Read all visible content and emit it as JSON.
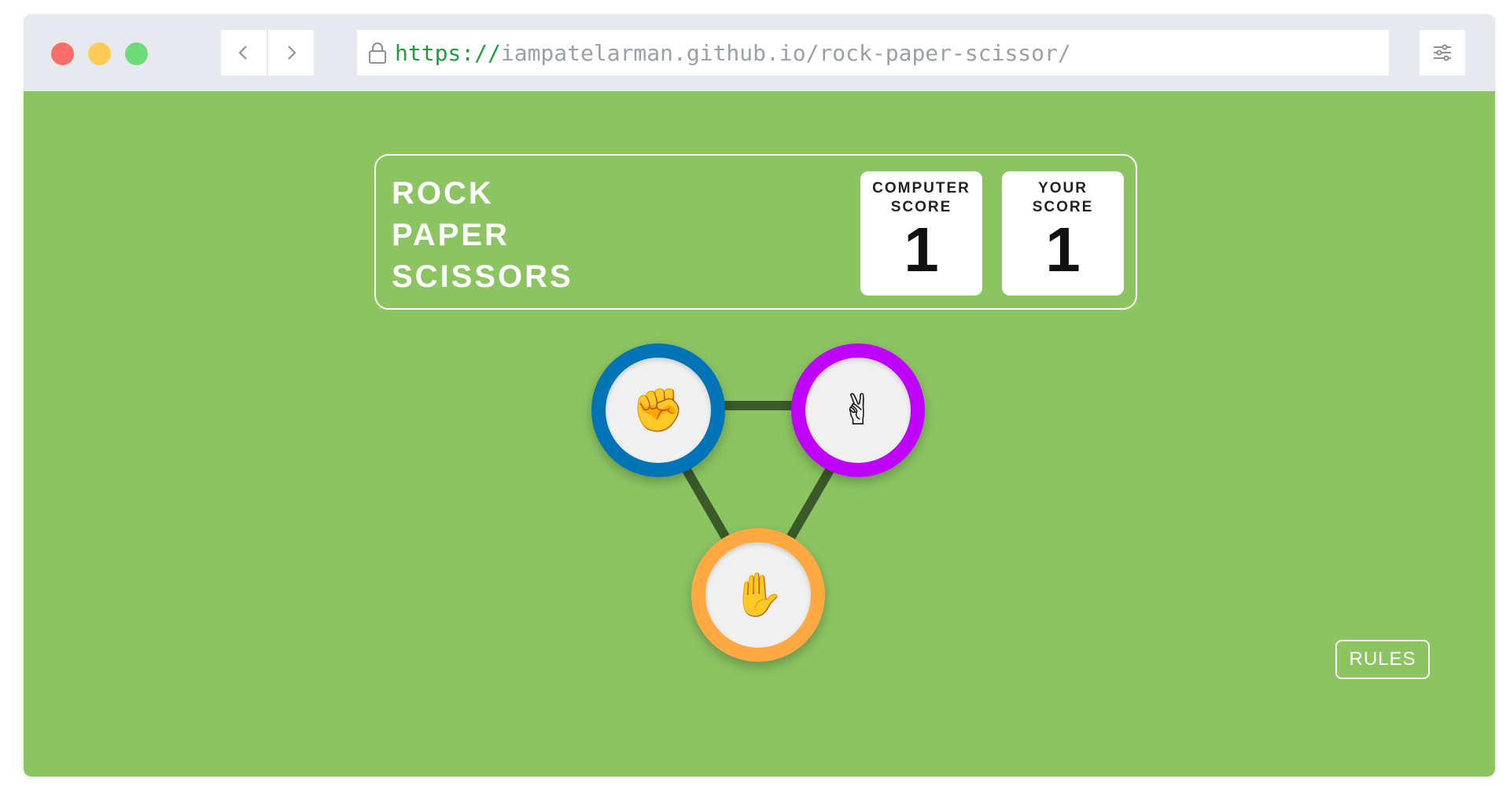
{
  "browser": {
    "url_protocol": "https://",
    "url_rest": "iampatelarman.github.io/rock-paper-scissor/",
    "icons": {
      "back": "chevron-left-icon",
      "forward": "chevron-right-icon",
      "lock": "lock-icon",
      "menu": "sliders-icon"
    }
  },
  "header": {
    "title_lines": [
      "ROCK",
      "PAPER",
      "SCISSORS"
    ],
    "computer_score": {
      "label_line1": "COMPUTER",
      "label_line2": "SCORE",
      "value": "1"
    },
    "your_score": {
      "label_line1": "YOUR",
      "label_line2": "SCORE",
      "value": "1"
    }
  },
  "choices": {
    "rock": {
      "icon": "rock-fist-icon",
      "glyph": "✊",
      "color": "#0074b7"
    },
    "scissors": {
      "icon": "scissors-hand-icon",
      "glyph": "✌",
      "color": "#bd00ff"
    },
    "paper": {
      "icon": "paper-hand-icon",
      "glyph": "✋",
      "color": "#ffa943"
    }
  },
  "rules_button": {
    "label": "RULES"
  },
  "colors": {
    "background": "#8cc462",
    "connector": "#3a5a2a",
    "white": "#ffffff"
  }
}
